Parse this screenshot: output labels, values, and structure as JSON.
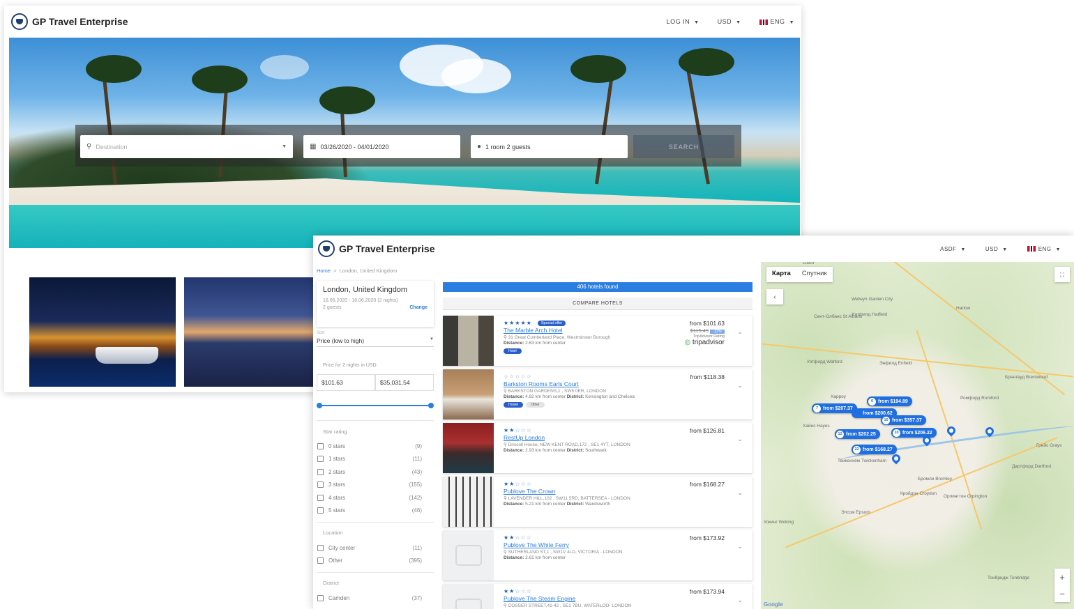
{
  "brand": {
    "name": "GP Travel Enterprise"
  },
  "landing": {
    "nav": {
      "login": "LOG IN",
      "currency": "USD",
      "language": "ENG"
    },
    "search": {
      "destination_placeholder": "Destination",
      "dates": "03/26/2020 - 04/01/2020",
      "guests": "1 room 2 guests",
      "search_label": "SEARCH"
    }
  },
  "results": {
    "nav": {
      "user": "ASDF",
      "currency": "USD",
      "language": "ENG"
    },
    "breadcrumb": {
      "home": "Home",
      "separator": ">",
      "current": "London, United Kingdom"
    },
    "location": {
      "title": "London, United Kingdom",
      "dates": "16.06.2020 - 18.06.2020 (2 nights)",
      "guests": "2 guests",
      "change_label": "Change"
    },
    "sort": {
      "label": "Sort",
      "value": "Price (low to high)"
    },
    "price": {
      "label": "Price for 2 nights in USD",
      "min": "$101.63",
      "max": "$35,031.54"
    },
    "star_rating": {
      "title": "Star rating",
      "items": [
        {
          "label": "0 stars",
          "count": "(9)"
        },
        {
          "label": "1 stars",
          "count": "(11)"
        },
        {
          "label": "2 stars",
          "count": "(43)"
        },
        {
          "label": "3 stars",
          "count": "(155)"
        },
        {
          "label": "4 stars",
          "count": "(142)"
        },
        {
          "label": "5 stars",
          "count": "(46)"
        }
      ]
    },
    "location_filter": {
      "title": "Location",
      "items": [
        {
          "label": "City center",
          "count": "(11)"
        },
        {
          "label": "Other",
          "count": "(395)"
        }
      ]
    },
    "district_filter": {
      "title": "District",
      "items": [
        {
          "label": "Camden",
          "count": "(37)"
        }
      ]
    },
    "found": "406 hotels found",
    "compare_label": "COMPARE HOTELS",
    "hotels": [
      {
        "stars": "★★★★★",
        "stars_off": "",
        "badge": "Special offer",
        "name": "The Marble Arch Hotel",
        "address": "31 Great Cumberland Place, Westminster Borough",
        "distance_label": "Distance:",
        "distance": "2.63  km from center",
        "district_label": "",
        "district": "",
        "tags": [
          "Hotel"
        ],
        "price": "from $101.63",
        "old_price": "$115.49",
        "discount": "-12%",
        "rating_label": "TripAdvisor Rating",
        "rating_logo": "tripadvisor"
      },
      {
        "stars": "",
        "stars_off": "☆☆☆☆☆",
        "badge": "",
        "name": "Barkston Rooms Earls Court",
        "address": "BARKSTON GARDENS,1 , SW5 0ER, LONDON",
        "distance_label": "Distance:",
        "distance": "4.82  km from center",
        "district_label": "District:",
        "district": "Kensington and Chelsea",
        "tags": [
          "Hostel",
          "Other"
        ],
        "price": "from $118.38"
      },
      {
        "stars": "★★",
        "stars_off": "☆☆☆",
        "badge": "",
        "name": "RestUp London",
        "address": "Driscoll House, NEW KENT ROAD,172 , SE1 4YT, LONDON",
        "distance_label": "Distance:",
        "distance": "2.93  km from center",
        "district_label": "District:",
        "district": "Southwark",
        "tags": [],
        "price": "from $126.81"
      },
      {
        "stars": "★★",
        "stars_off": "☆☆☆",
        "badge": "",
        "name": "Publove The Crown",
        "address": "LAVENDER HILL,102 , SW11 5RD, BATTERSEA - LONDON",
        "distance_label": "Distance:",
        "distance": "5.21  km from center",
        "district_label": "District:",
        "district": "Wandsworth",
        "tags": [],
        "price": "from $168.27"
      },
      {
        "stars": "★★",
        "stars_off": "☆☆☆",
        "badge": "",
        "name": "Publove The White Ferry",
        "address": "SUTHERLAND ST,1 , SW1V 4LD, VICTORIA - LONDON",
        "distance_label": "Distance:",
        "distance": "2.61  km from center",
        "district_label": "",
        "district": "",
        "tags": [],
        "price": "from $173.92"
      },
      {
        "stars": "★★",
        "stars_off": "☆☆☆",
        "badge": "",
        "name": "Publove The Steam Engine",
        "address": "COSSER STREET,41-42 , SE1 7BU, WATERLOO- LONDON",
        "distance_label": "",
        "distance": "",
        "district_label": "",
        "district": "",
        "tags": [],
        "price": "from $173.94"
      }
    ],
    "map": {
      "tabs": [
        "Карта",
        "Спутник"
      ],
      "pins": [
        {
          "num": "7",
          "price": "from $207.37"
        },
        {
          "num": "6",
          "price": "from $194.89"
        },
        {
          "num": "",
          "price": "from $200.62"
        },
        {
          "num": "10",
          "price": "from $357.37"
        },
        {
          "num": "12",
          "price": "from $202.25"
        },
        {
          "num": "10",
          "price": "from $206.22"
        },
        {
          "num": "22",
          "price": "from $168.27"
        }
      ],
      "places": [
        "Luton",
        "Welwyn Garden City",
        "Harlow",
        "Сент-Олбанс St Albans",
        "Хатфилд Hatfield",
        "Уотфорд Watford",
        "Энфилд Enfield",
        "Брентвуд Brentwood",
        "Харроу",
        "Ромфорд Romford",
        "Хайес Hayes",
        "Твикенхем Twickenham",
        "Бромли Bromley",
        "Кройдон Croydon",
        "Дартфорд Dartford",
        "Грейс Grays",
        "Эпсом Epsom",
        "Уокинг Woking",
        "Орпингтон Orpington",
        "Тонбридж Tonbridge"
      ],
      "attribution": "Google",
      "zoom_in": "+",
      "zoom_out": "−"
    }
  },
  "colors": {
    "accent": "#2a7de1",
    "pin": "#1f6fe0",
    "brand": "#1f3f6b"
  },
  "icons": [
    "logo-icon",
    "location-pin-icon",
    "calendar-icon",
    "person-icon",
    "chevron-down-icon",
    "fullscreen-icon",
    "back-arrow-icon",
    "zoom-in-icon",
    "zoom-out-icon",
    "map-marker-icon"
  ]
}
